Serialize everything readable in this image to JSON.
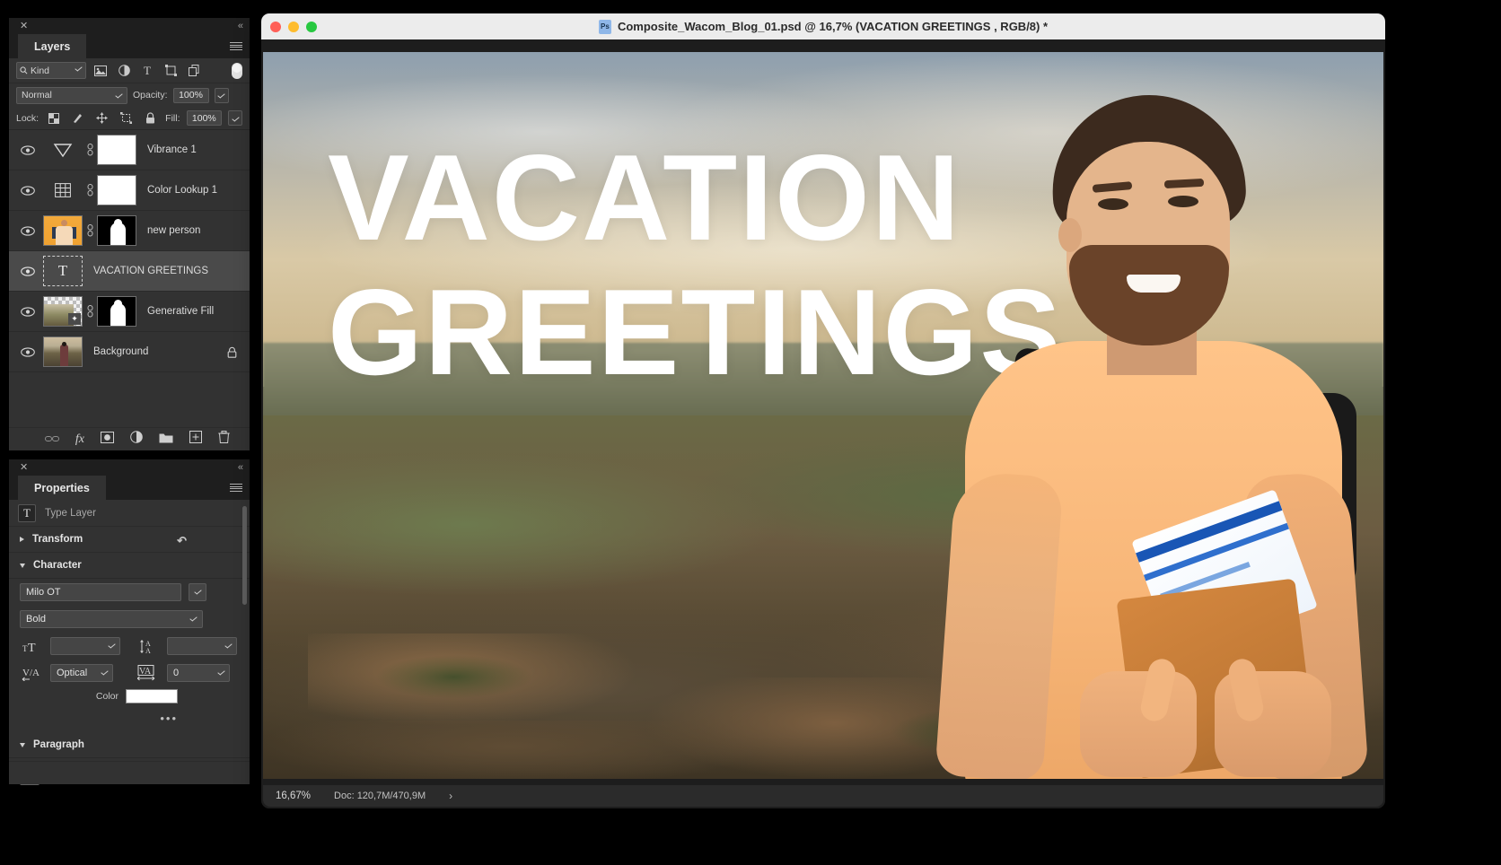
{
  "layers_panel": {
    "close_label": "✕",
    "collapse_label": "«",
    "tab_label": "Layers",
    "menu_icon": "hamburger-menu-icon",
    "filter": {
      "kind_label": "Kind",
      "search_icon": "search-icon",
      "filter_icons": [
        "image-filter-icon",
        "adjustment-filter-icon",
        "type-filter-icon",
        "shape-filter-icon",
        "smart-object-filter-icon"
      ],
      "toggle_icon": "filter-toggle-switch"
    },
    "blend": {
      "mode": "Normal",
      "opacity_label": "Opacity:",
      "opacity_value": "100%"
    },
    "lock": {
      "label": "Lock:",
      "icons": [
        "lock-transparent-pixels-icon",
        "lock-image-pixels-icon",
        "lock-position-icon",
        "lock-artboard-nesting-icon",
        "lock-all-icon"
      ],
      "fill_label": "Fill:",
      "fill_value": "100%"
    },
    "layers": [
      {
        "name": "Vibrance 1",
        "visible": true,
        "type": "adjustment-vibrance",
        "icon": "vibrance-icon",
        "has_link": true,
        "has_mask": true,
        "mask": "white",
        "selected": false,
        "locked": false
      },
      {
        "name": "Color Lookup 1",
        "visible": true,
        "type": "adjustment-lookup",
        "icon": "color-lookup-icon",
        "has_link": true,
        "has_mask": true,
        "mask": "white",
        "selected": false,
        "locked": false
      },
      {
        "name": "new person",
        "visible": true,
        "type": "pixel",
        "icon": "person-thumbnail",
        "has_link": true,
        "has_mask": true,
        "mask": "figure",
        "selected": false,
        "locked": false
      },
      {
        "name": "VACATION GREETINGS",
        "visible": true,
        "type": "text",
        "icon": "type-layer-icon",
        "has_link": false,
        "has_mask": false,
        "mask": "",
        "selected": true,
        "locked": false
      },
      {
        "name": "Generative Fill",
        "visible": true,
        "type": "pixel",
        "icon": "generative-fill-thumbnail",
        "has_link": true,
        "has_mask": true,
        "mask": "figure",
        "selected": false,
        "locked": false
      },
      {
        "name": "Background",
        "visible": true,
        "type": "pixel",
        "icon": "background-thumbnail",
        "has_link": false,
        "has_mask": false,
        "mask": "",
        "selected": false,
        "locked": true
      }
    ],
    "footer_icons": [
      "link-layers-icon",
      "layer-style-fx-icon",
      "add-layer-mask-icon",
      "new-adjustment-layer-icon",
      "new-group-icon",
      "new-layer-icon",
      "delete-layer-icon"
    ]
  },
  "properties_panel": {
    "close_label": "✕",
    "collapse_label": "«",
    "tab_label": "Properties",
    "menu_icon": "hamburger-menu-icon",
    "layer_kind_icon": "type-layer-icon",
    "layer_kind_label": "Type Layer",
    "transform": {
      "label": "Transform",
      "expanded": false,
      "reset_icon": "reset-icon"
    },
    "character": {
      "label": "Character",
      "expanded": true,
      "font_family": "Milo OT",
      "font_style": "Bold",
      "font_size_value": "",
      "font_size_icon": "font-size-icon",
      "leading_value": "",
      "leading_icon": "leading-icon",
      "kerning_label": "Optical",
      "kerning_icon": "kerning-icon",
      "tracking_value": "0",
      "tracking_icon": "tracking-icon",
      "color_label": "Color",
      "color_value": "#ffffff",
      "more_label": "•••"
    },
    "paragraph": {
      "label": "Paragraph",
      "expanded": true,
      "align_buttons": [
        "align-left-icon",
        "align-center-icon",
        "align-right-icon",
        "justify-last-left-icon",
        "justify-last-center-icon",
        "justify-last-right-icon",
        "justify-all-icon"
      ],
      "active_align": 0
    }
  },
  "document_window": {
    "title": "Composite_Wacom_Blog_01.psd @ 16,7% (VACATION GREETINGS , RGB/8) *",
    "app_badge": "Ps",
    "traffic_lights": [
      "close-button",
      "minimize-button",
      "zoom-button"
    ],
    "canvas": {
      "headline_line1": "VACATION",
      "headline_line2": "GREETINGS",
      "headline_color": "#ffffff"
    },
    "status_bar": {
      "zoom": "16,67%",
      "doc_label": "Doc: 120,7M/470,9M",
      "expand_icon": "›"
    }
  }
}
